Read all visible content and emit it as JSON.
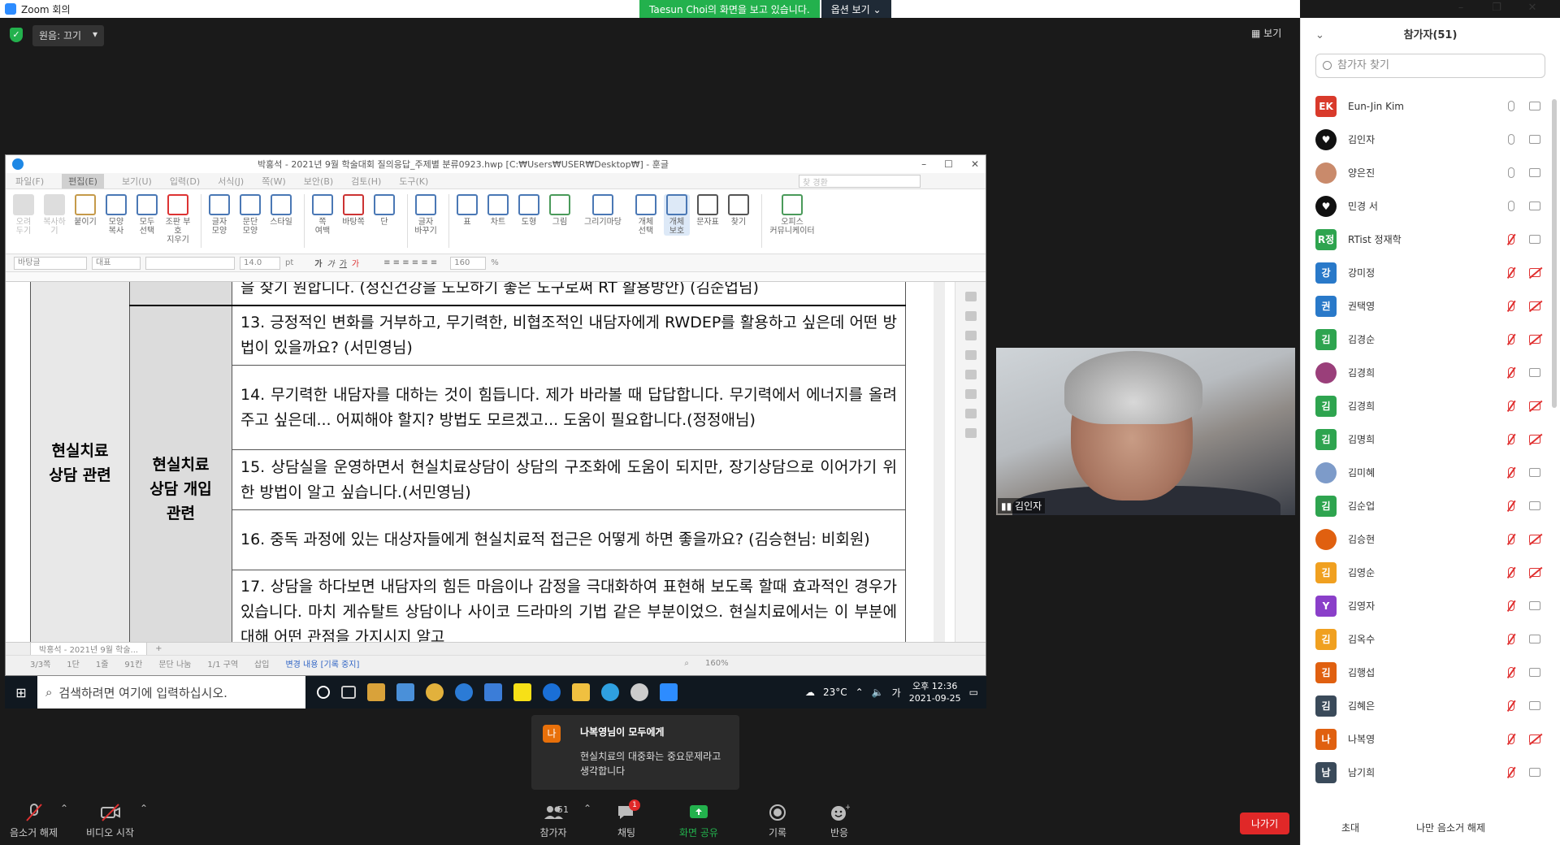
{
  "zoom": {
    "title": "Zoom 회의",
    "share_banner": "Taesun Choi의 화면을 보고 있습니다.",
    "view_options": "옵션 보기 ⌄",
    "original_sound": "원음: 끄기",
    "view_label": "보기",
    "window_controls": [
      "–",
      "❐",
      "✕"
    ]
  },
  "hwp": {
    "title": "박홍석 - 2021년 9월 학술대회 질의응답_주제별 분류0923.hwp [C:₩Users₩USER₩Desktop₩] - 훈글",
    "menu": [
      "파일(F)",
      "편집(E)",
      "보기(U)",
      "입력(D)",
      "서식(J)",
      "쪽(W)",
      "보안(B)",
      "검토(H)",
      "도구(K)"
    ],
    "search_placeholder": "찾 경환",
    "ribbon": [
      {
        "label": "오려\n두기",
        "dim": true
      },
      {
        "label": "복사하기",
        "dim": true
      },
      {
        "label": "붙이기",
        "dim": false
      },
      {
        "label": "모양\n복사",
        "dim": false
      },
      {
        "label": "모두\n선택",
        "dim": false
      },
      {
        "label": "조판 부호\n지우기",
        "dim": false
      },
      {
        "label": "글자\n모양",
        "dim": false
      },
      {
        "label": "문단\n모양",
        "dim": false
      },
      {
        "label": "스타일",
        "dim": false
      },
      {
        "label": "쪽\n여백",
        "dim": false
      },
      {
        "label": "바탕쪽",
        "dim": false
      },
      {
        "label": "단",
        "dim": false
      },
      {
        "label": "글자\n바꾸기",
        "dim": false
      },
      {
        "label": "표",
        "dim": false
      },
      {
        "label": "차트",
        "dim": false
      },
      {
        "label": "도형",
        "dim": false
      },
      {
        "label": "그림",
        "dim": false
      },
      {
        "label": "그리기마당",
        "dim": false
      },
      {
        "label": "개체\n선택",
        "dim": false
      },
      {
        "label": "개체\n보호",
        "dim": false
      },
      {
        "label": "문자표",
        "dim": false
      },
      {
        "label": "찾기",
        "dim": false
      },
      {
        "label": "오피스\n커뮤니케이터",
        "dim": false
      }
    ],
    "format": {
      "style": "바탕글",
      "lang": "대표",
      "font": "",
      "size": "14.0",
      "unit": "pt",
      "spacing": "160",
      "percent": "%"
    },
    "table": {
      "first_row": "을 찾기 원합니다. (정신건강을 도모하기 좋은 도구로써 RT 활용방안) (김순업님)",
      "category1": "현실치료\n상담 관련",
      "category2": "현실치료\n상담 개입\n관련",
      "questions": [
        "13. 긍정적인 변화를 거부하고, 무기력한, 비협조적인 내담자에게 RWDEP를 활용하고 싶은데 어떤 방법이 있을까요? (서민영님)",
        "14. 무기력한 내담자를 대하는 것이 힘듭니다. 제가 바라볼 때 답답합니다. 무기력에서 에너지를 올려주고 싶은데... 어찌해야 할지? 방법도 모르겠고... 도움이 필요합니다.(정정애님)",
        "15. 상담실을 운영하면서 현실치료상담이 상담의 구조화에 도움이 되지만, 장기상담으로 이어가기 위한 방법이 알고 싶습니다.(서민영님)",
        "16. 중독 과정에 있는 대상자들에게 현실치료적 접근은 어떻게 하면 좋을까요? (김승현님: 비회원)",
        "17. 상담을 하다보면 내담자의 힘든 마음이나 감정을 극대화하여 표현해 보도록 할때 효과적인 경우가 있습니다. 마치 게슈탈트 상담이나 사이코 드라마의 기법 같은 부분이었으. 현실치료에서는 이 부분에 대해 어떤 관점을 가지시지 알고"
      ]
    },
    "doc_tab": "박홍석 - 2021년 9월 학술...",
    "status": [
      "3/3쪽",
      "1단",
      "1줄",
      "91칸",
      "문단 나눔",
      "1/1 구역",
      "삽입"
    ],
    "status_change": "변경 내용 [기록 중지]",
    "zoom_level": "160%"
  },
  "taskbar": {
    "search_placeholder": "검색하려면 여기에 입력하십시오.",
    "temperature": "23°C",
    "ime": "가",
    "time": "오후 12:36",
    "date": "2021-09-25"
  },
  "video": {
    "name": "김인자"
  },
  "chat_toast": {
    "avatar": "나",
    "from": "나복영님이 모두에게",
    "message": "현실치료의 대중화는 중요문제라고 생각합니다"
  },
  "bottom": {
    "unmute": "음소거 해제",
    "start_video": "비디오 시작",
    "participants": "참가자",
    "participant_count": "51",
    "chat": "채팅",
    "chat_badge": "1",
    "share": "화면 공유",
    "record": "기록",
    "reactions": "반응",
    "leave": "나가기"
  },
  "panel": {
    "title": "참가자(51)",
    "search_placeholder": "참가자 찾기",
    "participants": [
      {
        "initial": "EK",
        "name": "Eun-Jin Kim",
        "color": "#d93a2b",
        "mic_muted": false,
        "cam_off": false,
        "img": false
      },
      {
        "initial": "♥",
        "name": "김인자",
        "color": "#111111",
        "mic_muted": false,
        "cam_off": false,
        "img": true
      },
      {
        "initial": "",
        "name": "양은진",
        "color": "#c98a6b",
        "mic_muted": false,
        "cam_off": false,
        "img": true
      },
      {
        "initial": "♥",
        "name": "민경 서",
        "color": "#111111",
        "mic_muted": false,
        "cam_off": false,
        "img": true
      },
      {
        "initial": "R정",
        "name": "RTist 정재학",
        "color": "#2ea44f",
        "mic_muted": true,
        "cam_off": false,
        "img": false
      },
      {
        "initial": "강",
        "name": "강미정",
        "color": "#2979c9",
        "mic_muted": true,
        "cam_off": true,
        "img": false
      },
      {
        "initial": "권",
        "name": "권택영",
        "color": "#2979c9",
        "mic_muted": true,
        "cam_off": true,
        "img": false
      },
      {
        "initial": "김",
        "name": "김경순",
        "color": "#2ea44f",
        "mic_muted": true,
        "cam_off": true,
        "img": false
      },
      {
        "initial": "",
        "name": "김경희",
        "color": "#9a3f7a",
        "mic_muted": true,
        "cam_off": false,
        "img": true
      },
      {
        "initial": "김",
        "name": "김경희",
        "color": "#2ea44f",
        "mic_muted": true,
        "cam_off": true,
        "img": false
      },
      {
        "initial": "김",
        "name": "김명희",
        "color": "#2ea44f",
        "mic_muted": true,
        "cam_off": true,
        "img": false
      },
      {
        "initial": "",
        "name": "김미혜",
        "color": "#7d9bc9",
        "mic_muted": true,
        "cam_off": false,
        "img": true
      },
      {
        "initial": "김",
        "name": "김순업",
        "color": "#2ea44f",
        "mic_muted": true,
        "cam_off": false,
        "img": false
      },
      {
        "initial": "",
        "name": "김승현",
        "color": "#e06010",
        "mic_muted": true,
        "cam_off": true,
        "img": true
      },
      {
        "initial": "김",
        "name": "김영순",
        "color": "#f0a020",
        "mic_muted": true,
        "cam_off": true,
        "img": false
      },
      {
        "initial": "Y",
        "name": "김영자",
        "color": "#8a3fc9",
        "mic_muted": true,
        "cam_off": false,
        "img": false
      },
      {
        "initial": "김",
        "name": "김옥수",
        "color": "#f0a020",
        "mic_muted": true,
        "cam_off": false,
        "img": false
      },
      {
        "initial": "김",
        "name": "김행섭",
        "color": "#e06010",
        "mic_muted": true,
        "cam_off": false,
        "img": false
      },
      {
        "initial": "김",
        "name": "김혜은",
        "color": "#3a4a5a",
        "mic_muted": true,
        "cam_off": false,
        "img": false
      },
      {
        "initial": "나",
        "name": "나복영",
        "color": "#e06010",
        "mic_muted": true,
        "cam_off": true,
        "img": false
      },
      {
        "initial": "남",
        "name": "남기희",
        "color": "#3a4a5a",
        "mic_muted": true,
        "cam_off": false,
        "img": false
      }
    ],
    "invite": "초대",
    "mute_me": "나만 음소거 해제"
  }
}
